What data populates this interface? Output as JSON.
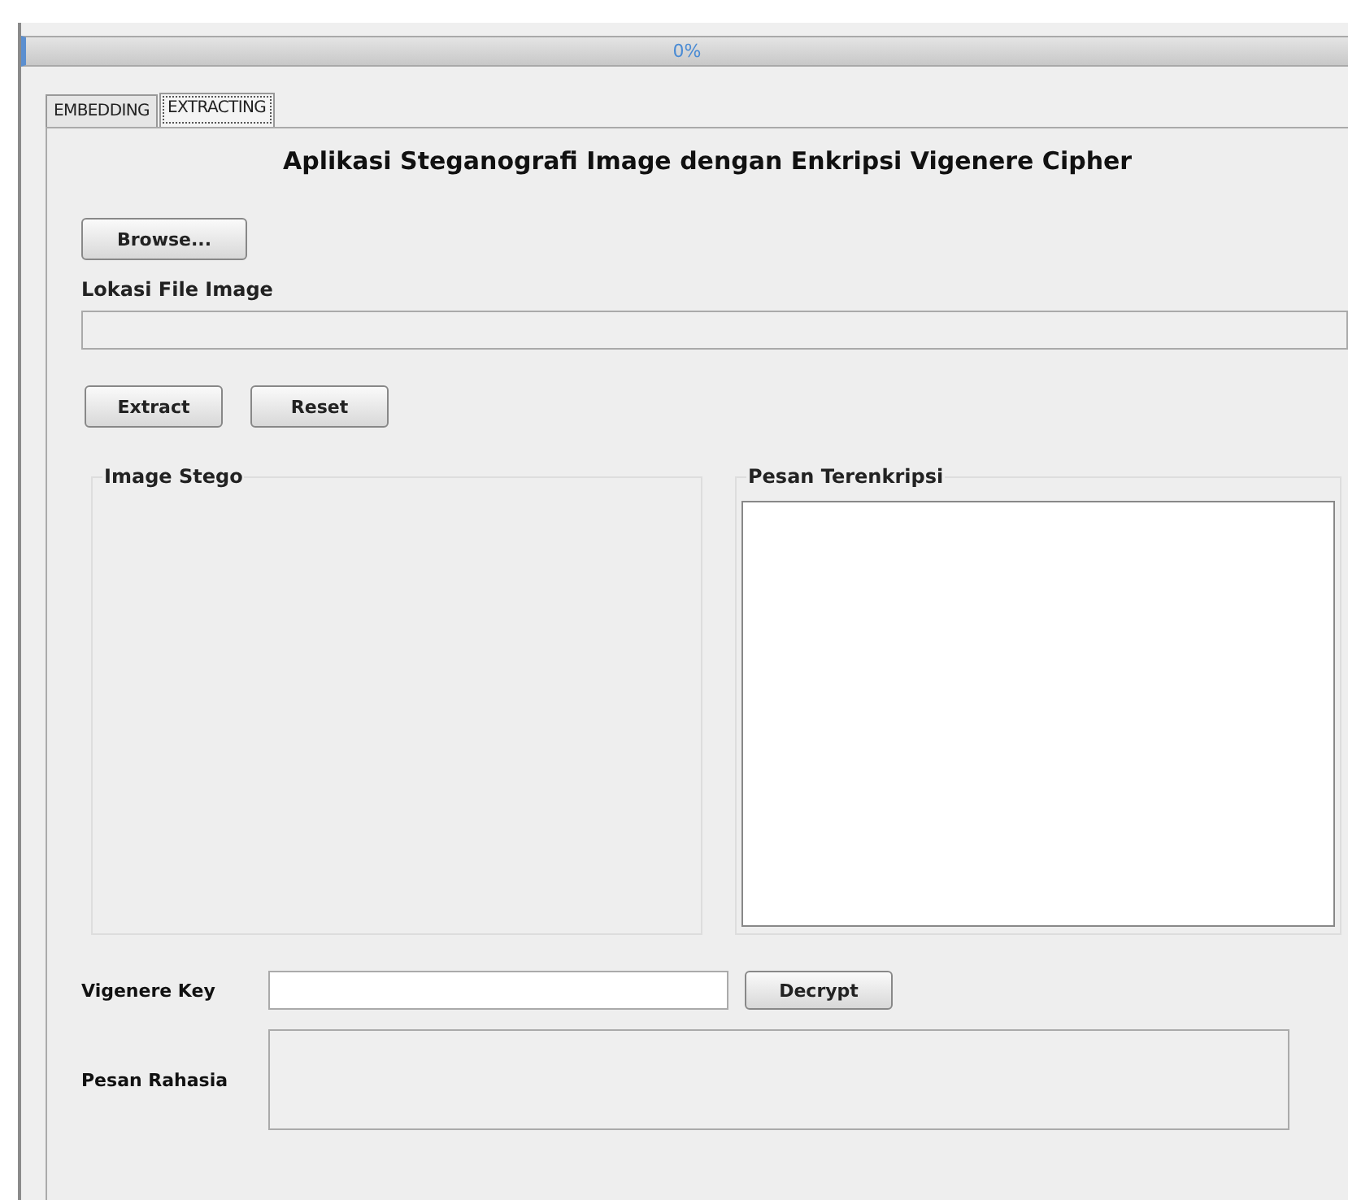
{
  "progress": {
    "level": 0,
    "reading": "0%"
  },
  "tabs": [
    {
      "label": "EMBEDDING",
      "selected": false
    },
    {
      "label": "EXTRACTING",
      "selected": true
    }
  ],
  "title": "Aplikasi Steganografi Image dengan Enkripsi Vigenere Cipher",
  "browse_button": "Browse...",
  "file_location_label": "Lokasi File Image",
  "action_buttons": [
    "Extract",
    "Reset"
  ],
  "image_panel": {
    "title": "Image Stego"
  },
  "encrypted_panel": {
    "title": "Pesan Terenkripsi"
  },
  "key_label": "Vigenere Key",
  "decrypt_button": "Decrypt",
  "secret_label": "Pesan Rahasia"
}
